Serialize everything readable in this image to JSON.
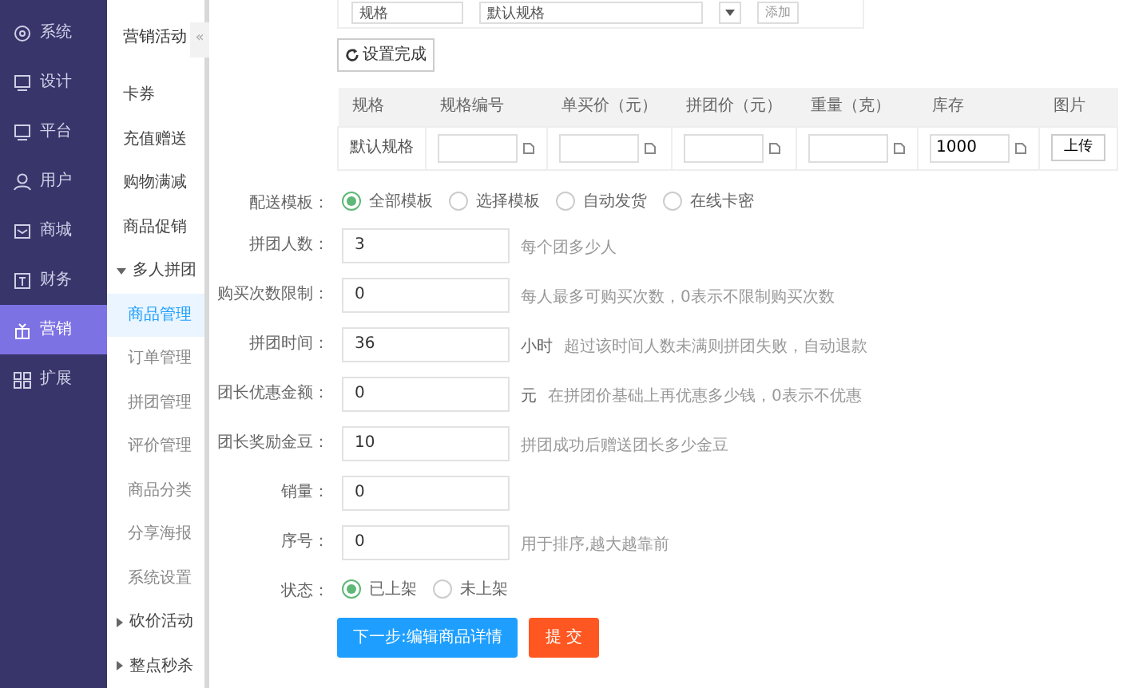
{
  "nav": {
    "items": [
      {
        "label": "系统",
        "selected": false
      },
      {
        "label": "设计",
        "selected": false
      },
      {
        "label": "平台",
        "selected": false
      },
      {
        "label": "用户",
        "selected": false
      },
      {
        "label": "商城",
        "selected": false
      },
      {
        "label": "财务",
        "selected": false
      },
      {
        "label": "营销",
        "selected": true
      },
      {
        "label": "扩展",
        "selected": false
      }
    ]
  },
  "subnav": {
    "title": "营销活动",
    "collapse": "«",
    "items": [
      {
        "label": "卡券",
        "kind": "link",
        "selected": false
      },
      {
        "label": "充值赠送",
        "kind": "link",
        "selected": false
      },
      {
        "label": "购物满减",
        "kind": "link",
        "selected": false
      },
      {
        "label": "商品促销",
        "kind": "link",
        "selected": false
      },
      {
        "label": "多人拼团",
        "kind": "group",
        "expanded": true,
        "children": [
          {
            "label": "商品管理",
            "selected": true
          },
          {
            "label": "订单管理",
            "selected": false
          },
          {
            "label": "拼团管理",
            "selected": false
          },
          {
            "label": "评价管理",
            "selected": false
          },
          {
            "label": "商品分类",
            "selected": false
          },
          {
            "label": "分享海报",
            "selected": false
          },
          {
            "label": "系统设置",
            "selected": false
          }
        ]
      },
      {
        "label": "砍价活动",
        "kind": "group",
        "expanded": false
      },
      {
        "label": "整点秒杀",
        "kind": "group",
        "expanded": false
      }
    ]
  },
  "spec_editor": {
    "name_value": "规格",
    "default_value": "默认规格",
    "add_button": "添加",
    "done_button": "设置完成"
  },
  "spec_table": {
    "columns": [
      "规格",
      "规格编号",
      "单买价（元）",
      "拼团价（元）",
      "重量（克）",
      "库存",
      "图片"
    ],
    "row": {
      "spec": "默认规格",
      "fields": [
        {
          "kind": "input"
        },
        {
          "kind": "input"
        },
        {
          "kind": "input"
        },
        {
          "kind": "input"
        },
        {
          "kind": "input",
          "value": "1000"
        }
      ],
      "upload": "上传"
    }
  },
  "form": [
    {
      "kind": "radio",
      "label": "配送模板：",
      "options": [
        {
          "label": "全部模板",
          "selected": true
        },
        {
          "label": "选择模板",
          "selected": false
        },
        {
          "label": "自动发货",
          "selected": false
        },
        {
          "label": "在线卡密",
          "selected": false
        }
      ]
    },
    {
      "kind": "input",
      "label": "拼团人数：",
      "value": "3",
      "hint": "每个团多少人"
    },
    {
      "kind": "input",
      "label": "购买次数限制：",
      "value": "0",
      "hint": "每人最多可购买次数，0表示不限制购买次数"
    },
    {
      "kind": "input",
      "label": "拼团时间：",
      "value": "36",
      "unit": "小时",
      "hint": "超过该时间人数未满则拼团失败，自动退款"
    },
    {
      "kind": "input",
      "label": "团长优惠金额：",
      "value": "0",
      "unit": "元",
      "hint": "在拼团价基础上再优惠多少钱，0表示不优惠"
    },
    {
      "kind": "input",
      "label": "团长奖励金豆：",
      "value": "10",
      "hint": "拼团成功后赠送团长多少金豆"
    },
    {
      "kind": "input",
      "label": "销量：",
      "value": "0"
    },
    {
      "kind": "input",
      "label": "序号：",
      "value": "0",
      "hint": "用于排序,越大越靠前"
    },
    {
      "kind": "radio",
      "label": "状态：",
      "options": [
        {
          "label": "已上架",
          "selected": true
        },
        {
          "label": "未上架",
          "selected": false
        }
      ]
    }
  ],
  "buttons": [
    {
      "label": "下一步:编辑商品详情",
      "kind": "primary"
    },
    {
      "label": "提 交",
      "kind": "danger"
    }
  ]
}
